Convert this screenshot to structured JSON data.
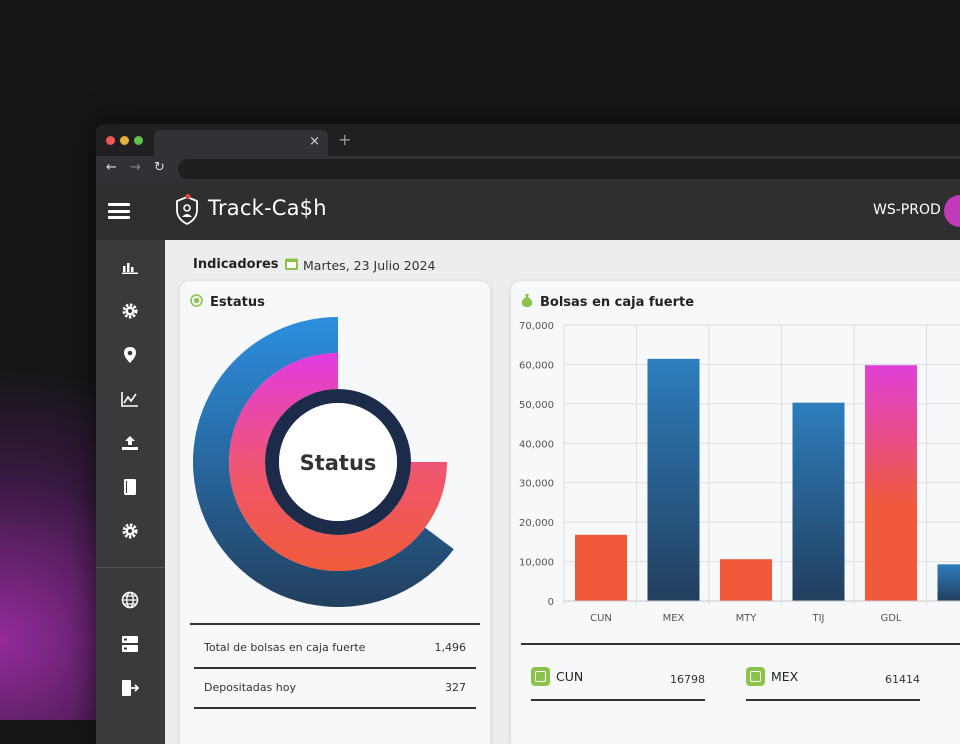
{
  "browser": {
    "tab_close": "×",
    "new_tab": "+",
    "back": "←",
    "forward": "→",
    "reload": "↻"
  },
  "app": {
    "name": "Track-Ca$h",
    "environment": "WS-PROD"
  },
  "page": {
    "section": "Indicadores",
    "date": "Martes, 23 Julio 2024"
  },
  "status_card": {
    "title": "Estatus",
    "center_label": "Status",
    "rows": [
      {
        "label": "Total de bolsas en caja fuerte",
        "value": "1,496"
      },
      {
        "label": "Depositadas hoy",
        "value": "327"
      }
    ]
  },
  "bags_card": {
    "title": "Bolsas en caja fuerte",
    "legend": [
      {
        "name": "CUN",
        "value": "16798"
      },
      {
        "name": "MEX",
        "value": "61414"
      }
    ]
  },
  "chart_data": {
    "type": "bar",
    "title": "Bolsas en caja fuerte",
    "categories": [
      "CUN",
      "MEX",
      "MTY",
      "TIJ",
      "GDL",
      "E"
    ],
    "values": [
      16798,
      61414,
      10600,
      50300,
      59800,
      9300
    ],
    "ylim": [
      0,
      70000
    ],
    "yticks": [
      "0",
      "10,000",
      "20,000",
      "30,000",
      "40,000",
      "50,000",
      "60,000",
      "70,000"
    ],
    "grid": true,
    "colors": {
      "orange": "#f05a3a",
      "navy": "#223f5e",
      "blue": "#2d7dbd",
      "magenta": "#e040d8"
    }
  },
  "colors": {
    "accent": "#8bc34a",
    "sidebar": "#3a3a3d",
    "header": "#2f2f31",
    "avatar": "#c13ab9"
  },
  "icons": {
    "sidebar": [
      "bar-chart-icon",
      "gear-icon",
      "location-pin-icon",
      "line-chart-icon",
      "upload-icon",
      "book-icon",
      "settings-icon",
      "globe-icon",
      "server-icon",
      "logout-icon"
    ]
  }
}
